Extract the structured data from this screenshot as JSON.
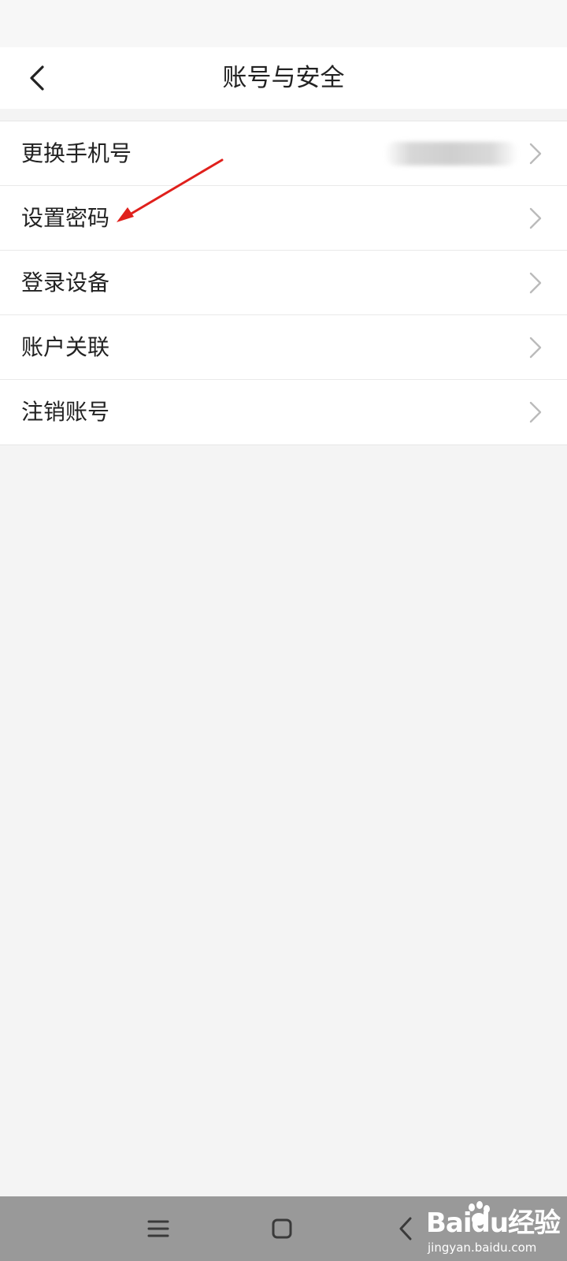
{
  "header": {
    "title": "账号与安全"
  },
  "settings": {
    "items": [
      {
        "label": "更换手机号"
      },
      {
        "label": "设置密码"
      },
      {
        "label": "登录设备"
      },
      {
        "label": "账户关联"
      },
      {
        "label": "注销账号"
      }
    ]
  },
  "watermark": {
    "logo_text": "Baidu经验",
    "url": "jingyan.baidu.com"
  },
  "colors": {
    "annotation_arrow": "#e0201c",
    "nav_bar": "#999999",
    "chevron": "#bbbbbb"
  }
}
